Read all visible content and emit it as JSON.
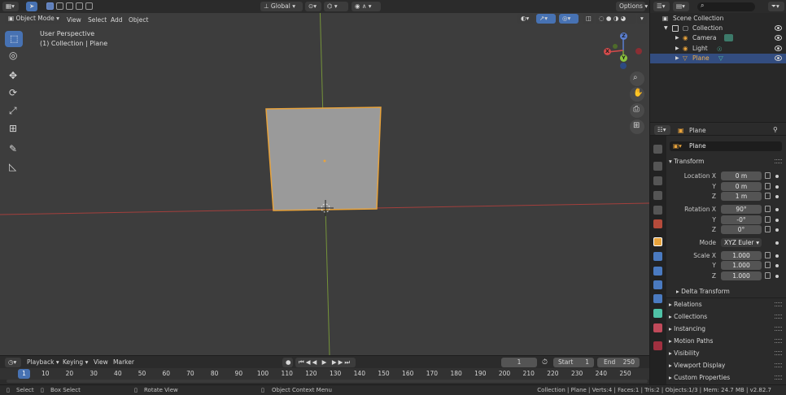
{
  "viewport": {
    "mode": "Object Mode",
    "menus": [
      "View",
      "Select",
      "Add",
      "Object"
    ],
    "transform_orientation": "Global",
    "options": "Options",
    "overlay_title": "User Perspective",
    "overlay_subtitle": "(1) Collection | Plane",
    "gizmo": {
      "x": "X",
      "y": "Y",
      "z": "Z"
    },
    "colors": {
      "bg": "#3d3d3d",
      "selection": "#e8a33c",
      "x_axis": "#b5403d",
      "y_axis": "#7fa33a",
      "plane": "#9a9a9a"
    },
    "tools": [
      "select-box-icon",
      "cursor-icon",
      "move-icon",
      "rotate-icon",
      "scale-icon",
      "transform-icon",
      "annotate-icon",
      "measure-icon"
    ]
  },
  "outliner": {
    "root": "Scene Collection",
    "items": [
      {
        "label": "Collection",
        "depth": 0
      },
      {
        "label": "Camera",
        "depth": 1
      },
      {
        "label": "Light",
        "depth": 1
      },
      {
        "label": "Plane",
        "depth": 1,
        "selected": true
      }
    ]
  },
  "properties": {
    "header_object": "Plane",
    "object_name": "Plane",
    "transform_title": "Transform",
    "location_label": "Location X",
    "rotation_label": "Rotation X",
    "scale_label": "Scale X",
    "mode_label": "Mode",
    "y_label": "Y",
    "z_label": "Z",
    "location": [
      "0 m",
      "0 m",
      "1 m"
    ],
    "rotation": [
      "90°",
      "-0°",
      "0°"
    ],
    "mode": "XYZ Euler",
    "scale": [
      "1.000",
      "1.000",
      "1.000"
    ],
    "delta_transform": "Delta Transform",
    "panels": [
      "Relations",
      "Collections",
      "Instancing",
      "Motion Paths",
      "Visibility",
      "Viewport Display",
      "Custom Properties"
    ]
  },
  "timeline": {
    "menus": [
      "Playback",
      "Keying",
      "View",
      "Marker"
    ],
    "current_frame": "1",
    "start_label": "Start",
    "start": "1",
    "end_label": "End",
    "end": "250",
    "ticks": [
      "10",
      "20",
      "30",
      "40",
      "50",
      "60",
      "70",
      "80",
      "90",
      "100",
      "110",
      "120",
      "130",
      "140",
      "150",
      "160",
      "170",
      "180",
      "190",
      "200",
      "210",
      "220",
      "230",
      "240",
      "250"
    ]
  },
  "statusbar": {
    "select": "Select",
    "box_select": "Box Select",
    "rotate_view": "Rotate View",
    "context_menu": "Object Context Menu",
    "stats": "Collection | Plane | Verts:4 | Faces:1 | Tris:2 | Objects:1/3 | Mem: 24.7 MB | v2.82.7"
  }
}
